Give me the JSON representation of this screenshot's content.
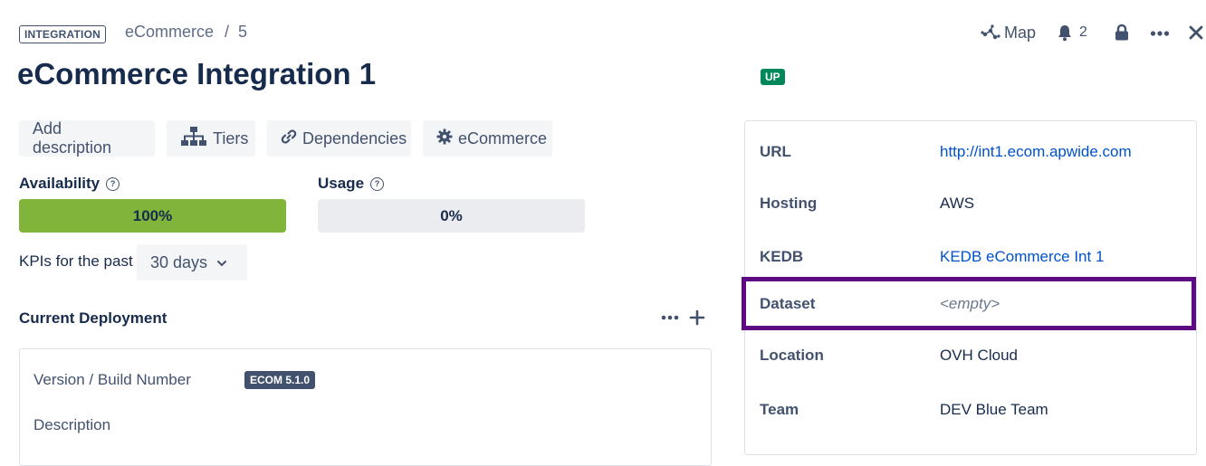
{
  "header": {
    "type_badge": "INTEGRATION",
    "breadcrumb_app": "eCommerce",
    "breadcrumb_sep": "/",
    "breadcrumb_index": "5",
    "title": "eCommerce Integration 1",
    "status_badge": "UP"
  },
  "top_actions": {
    "map_label": "Map",
    "notifications_count": "2",
    "icons": [
      "map-icon",
      "bell-icon",
      "lock-icon",
      "more-icon",
      "close-icon"
    ]
  },
  "toolbar": {
    "add_description": "Add description",
    "tiers": "Tiers",
    "dependencies": "Dependencies",
    "ecommerce": "eCommerce"
  },
  "kpi": {
    "availability_label": "Availability",
    "availability_value": "100%",
    "availability_fraction": 1.0,
    "usage_label": "Usage",
    "usage_value": "0%",
    "usage_fraction": 0.0,
    "period_label": "KPIs for the past",
    "period_value": "30 days"
  },
  "deployment": {
    "title": "Current Deployment",
    "version_label": "Version / Build Number",
    "version_badge": "ECOM 5.1.0",
    "description_label": "Description"
  },
  "details": [
    {
      "label": "URL",
      "value": "http://int1.ecom.apwide.com",
      "kind": "link"
    },
    {
      "label": "Hosting",
      "value": "AWS",
      "kind": "text"
    },
    {
      "label": "KEDB",
      "value": "KEDB eCommerce Int 1",
      "kind": "link"
    },
    {
      "label": "Dataset",
      "value": "<empty>",
      "kind": "empty"
    },
    {
      "label": "Location",
      "value": "OVH Cloud",
      "kind": "text"
    },
    {
      "label": "Team",
      "value": "DEV Blue Team",
      "kind": "text"
    }
  ],
  "colors": {
    "accent_link": "#0052cc",
    "status_up": "#00875a",
    "availability_fill": "#81b43a",
    "highlight_border": "#5e0a83"
  }
}
